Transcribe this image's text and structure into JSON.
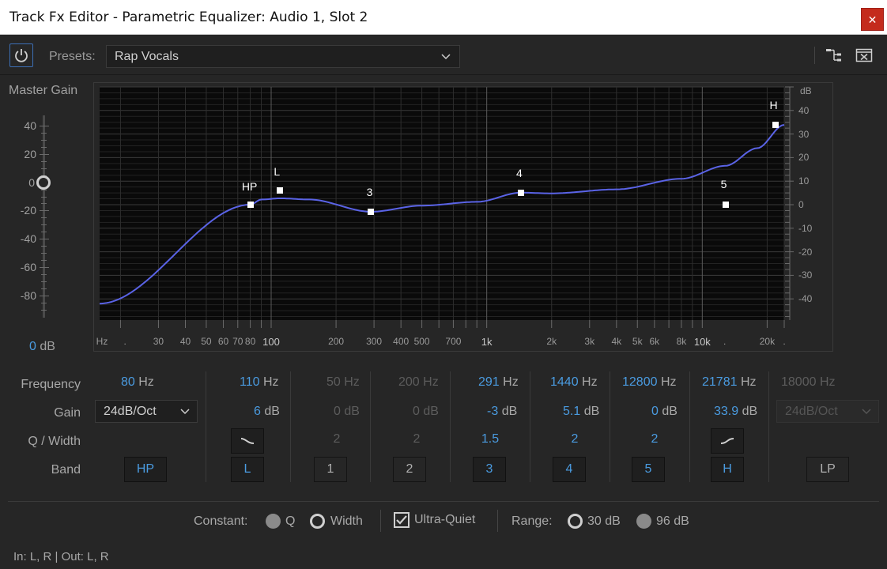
{
  "window": {
    "title": "Track Fx Editor - Parametric Equalizer: Audio 1, Slot 2",
    "close_glyph": "✕"
  },
  "toolbar": {
    "presets_label": "Presets:",
    "preset_value": "Rap Vocals"
  },
  "master_gain": {
    "label": "Master Gain",
    "scale": [
      "40",
      "20",
      "0",
      "-20",
      "-40",
      "-60",
      "-80"
    ],
    "value": "0",
    "unit": "dB",
    "level_db": 0
  },
  "graph": {
    "x_ticks": [
      "Hz",
      ".",
      "30",
      "40",
      "50",
      "60",
      "70",
      "80",
      "100",
      "200",
      "300",
      "400",
      "500",
      "700",
      "1k",
      "2k",
      "3k",
      "4k",
      "5k",
      "6k",
      "8k",
      "10k",
      ".",
      "20k",
      "."
    ],
    "y_unit": "dB",
    "y_ticks": [
      "40",
      "30",
      "20",
      "10",
      "0",
      "-10",
      "-20",
      "-30",
      "-40"
    ],
    "curve_color": "#5a63e6",
    "markers": [
      {
        "label": "HP",
        "freq": 80,
        "db": 0
      },
      {
        "label": "L",
        "freq": 110,
        "db": 6
      },
      {
        "label": "3",
        "freq": 291,
        "db": -3
      },
      {
        "label": "4",
        "freq": 1440,
        "db": 5.1
      },
      {
        "label": "5",
        "freq": 12800,
        "db": 0
      },
      {
        "label": "H",
        "freq": 21781,
        "db": 33.9
      }
    ]
  },
  "rows": {
    "frequency": "Frequency",
    "gain": "Gain",
    "q_width": "Q / Width",
    "band": "Band"
  },
  "bands": {
    "hp": {
      "freq": "80",
      "unit": "Hz",
      "slope": "24dB/Oct",
      "button": "HP"
    },
    "l": {
      "freq": "110",
      "freq_unit": "Hz",
      "gain": "6",
      "gain_unit": "dB",
      "button": "L"
    },
    "b1": {
      "freq": "50",
      "freq_unit": "Hz",
      "gain": "0",
      "gain_unit": "dB",
      "q": "2",
      "button": "1"
    },
    "b2": {
      "freq": "200",
      "freq_unit": "Hz",
      "gain": "0",
      "gain_unit": "dB",
      "q": "2",
      "button": "2"
    },
    "b3": {
      "freq": "291",
      "freq_unit": "Hz",
      "gain": "-3",
      "gain_unit": "dB",
      "q": "1.5",
      "button": "3"
    },
    "b4": {
      "freq": "1440",
      "freq_unit": "Hz",
      "gain": "5.1",
      "gain_unit": "dB",
      "q": "2",
      "button": "4"
    },
    "b5": {
      "freq": "12800",
      "freq_unit": "Hz",
      "gain": "0",
      "gain_unit": "dB",
      "q": "2",
      "button": "5"
    },
    "h": {
      "freq": "21781",
      "freq_unit": "Hz",
      "gain": "33.9",
      "gain_unit": "dB",
      "button": "H"
    },
    "lp": {
      "freq": "18000",
      "unit": "Hz",
      "slope": "24dB/Oct",
      "button": "LP"
    }
  },
  "footer": {
    "constant_label": "Constant:",
    "q_label": "Q",
    "width_label": "Width",
    "ultra_quiet_label": "Ultra-Quiet",
    "range_label": "Range:",
    "range_30": "30 dB",
    "range_96": "96 dB",
    "io": "In: L, R | Out: L, R"
  }
}
